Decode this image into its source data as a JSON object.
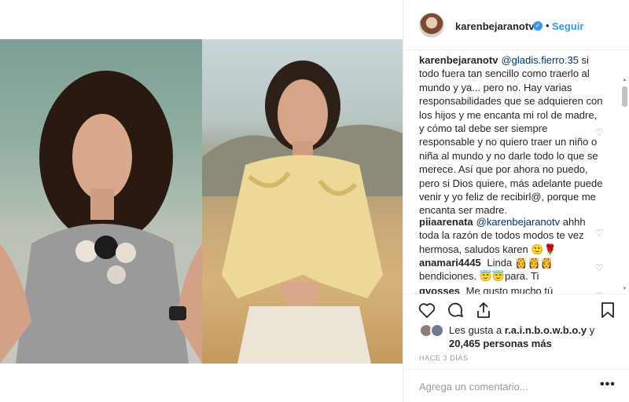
{
  "post": {
    "username": "karenbejaranotv",
    "follow_label": "Seguir",
    "separator": "•"
  },
  "comments": [
    {
      "author": "karenbejaranotv",
      "mention": "@gladis.fierro.35",
      "text": "si todo fuera tan sencillo como traerlo al mundo y ya... pero no. Hay varias responsabilidades que se adquieren con los hijos y me encanta mi rol de madre, y cómo tal debe ser siempre responsable y no quiero traer un niño o niña al mundo y no darle todo lo que se merece. Así que por ahora no puedo, pero si Dios quiere, más adelante puede venir y yo feliz de recibirl@, porque me encanta ser madre."
    },
    {
      "author": "piiaarenata",
      "mention": "@karenbejaranotv",
      "text": "ahhh toda la razón de todos modos te vez hermosa, saludos karen 🙂🌹"
    },
    {
      "author": "anamari4445",
      "mention": "",
      "text": "Linda 👸👸👸 bendiciones. 😇😇para. Ti"
    },
    {
      "author": "gvosses",
      "mention": "",
      "text": "Me gusto mucho tú"
    }
  ],
  "likes": {
    "prefix": "Les gusta a",
    "user": "r.a.i.n.b.o.w.b.o.y",
    "conjunction": "y",
    "count_text": "20,465 personas más"
  },
  "timestamp": "HACE 3 DÍAS",
  "comment_placeholder": "Agrega un comentario...",
  "more_label": "•••",
  "icons": {
    "verified": "✓",
    "heart": "♡"
  },
  "colors": {
    "link": "#3897f0",
    "mention": "#003569",
    "text": "#262626",
    "muted": "#999999"
  }
}
